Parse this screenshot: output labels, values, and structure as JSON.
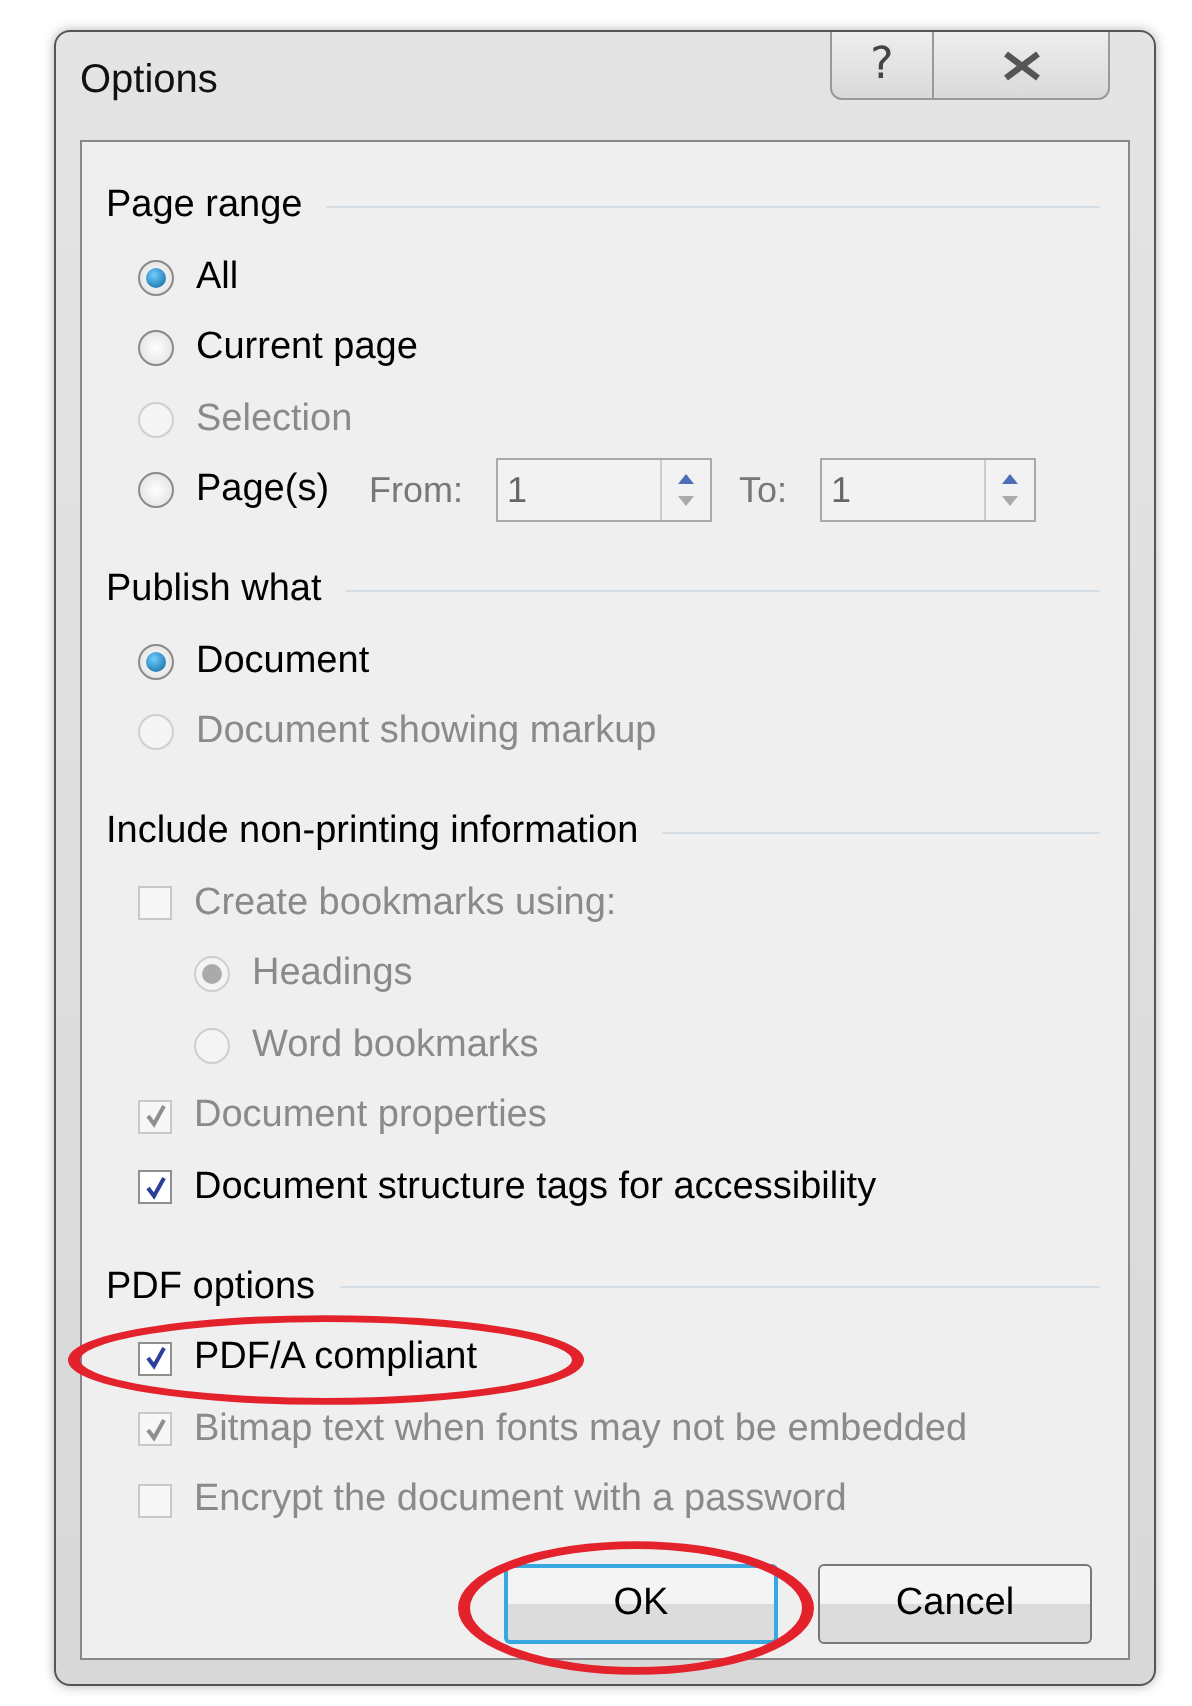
{
  "window": {
    "title": "Options",
    "help_button": "?"
  },
  "sections": [
    {
      "title": "Page range",
      "items": [
        {
          "kind": "radio",
          "label": "All",
          "selected": true,
          "disabled": false
        },
        {
          "kind": "radio",
          "label": "Current page",
          "selected": false,
          "disabled": false
        },
        {
          "kind": "radio",
          "label": "Selection",
          "selected": false,
          "disabled": true
        },
        {
          "kind": "range",
          "label": "Page(s)",
          "selected": false,
          "disabled": false,
          "from": {
            "label": "From:",
            "value": "1"
          },
          "to": {
            "label": "To:",
            "value": "1"
          }
        }
      ]
    },
    {
      "title": "Publish what",
      "items": [
        {
          "kind": "radio",
          "label": "Document",
          "selected": true,
          "disabled": false
        },
        {
          "kind": "radio",
          "label": "Document showing markup",
          "selected": false,
          "disabled": true
        }
      ]
    },
    {
      "title": "Include non-printing information",
      "items": [
        {
          "kind": "checkbox",
          "label": "Create bookmarks using:",
          "checked": false,
          "disabled": true,
          "children": [
            {
              "kind": "radio",
              "label": "Headings",
              "selected": true,
              "disabled": true
            },
            {
              "kind": "radio",
              "label": "Word bookmarks",
              "selected": false,
              "disabled": true
            }
          ]
        },
        {
          "kind": "checkbox",
          "label": "Document properties",
          "checked": true,
          "disabled": true
        },
        {
          "kind": "checkbox",
          "label": "Document structure tags for accessibility",
          "checked": true,
          "disabled": false
        }
      ]
    },
    {
      "title": "PDF options",
      "items": [
        {
          "kind": "checkbox",
          "label": "PDF/A compliant",
          "checked": true,
          "disabled": false,
          "highlighted": true
        },
        {
          "kind": "checkbox",
          "label": "Bitmap text when fonts may not be embedded",
          "checked": true,
          "disabled": true
        },
        {
          "kind": "checkbox",
          "label": "Encrypt the document with a password",
          "checked": false,
          "disabled": true
        }
      ]
    }
  ],
  "buttons": [
    {
      "label": "OK",
      "default": true,
      "highlighted": true
    },
    {
      "label": "Cancel",
      "default": false,
      "highlighted": false
    }
  ]
}
